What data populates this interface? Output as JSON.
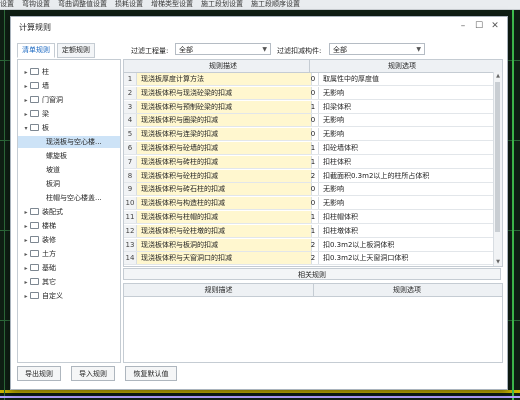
{
  "background": {
    "menu_items": [
      "设置",
      "弯钩设置",
      "弯曲调整值设置",
      "损耗设置",
      "增梯类型设置",
      "施工段划设置",
      "施工段顺序设置"
    ]
  },
  "dialog": {
    "title": "计算规则",
    "tabs": [
      "清单规则",
      "定额规则"
    ],
    "active_tab": 0,
    "filter_project_label": "过滤工程量:",
    "filter_project_value": "全部",
    "filter_deduct_label": "过滤扣减构件:",
    "filter_deduct_value": "全部"
  },
  "tree": [
    {
      "label": "柱",
      "type": "group",
      "expanded": false
    },
    {
      "label": "墙",
      "type": "group",
      "expanded": false
    },
    {
      "label": "门窗洞",
      "type": "group",
      "expanded": false
    },
    {
      "label": "梁",
      "type": "group",
      "expanded": false
    },
    {
      "label": "板",
      "type": "group",
      "expanded": true
    },
    {
      "label": "现浇板与空心楼...",
      "type": "leaf",
      "selected": true
    },
    {
      "label": "螺旋板",
      "type": "leaf"
    },
    {
      "label": "坡道",
      "type": "leaf"
    },
    {
      "label": "板洞",
      "type": "leaf"
    },
    {
      "label": "柱帽与空心楼盖...",
      "type": "leaf"
    },
    {
      "label": "装配式",
      "type": "group",
      "expanded": false
    },
    {
      "label": "楼梯",
      "type": "group",
      "expanded": false
    },
    {
      "label": "装修",
      "type": "group",
      "expanded": false
    },
    {
      "label": "土方",
      "type": "group",
      "expanded": false
    },
    {
      "label": "基础",
      "type": "group",
      "expanded": false
    },
    {
      "label": "其它",
      "type": "group",
      "expanded": false
    },
    {
      "label": "自定义",
      "type": "group",
      "expanded": false
    }
  ],
  "table": {
    "headers": [
      "规则描述",
      "规则选项"
    ],
    "rows": [
      {
        "idx": "1",
        "desc": "现浇板厚度计算方法",
        "val": "0",
        "opt": "取属性中的厚度值"
      },
      {
        "idx": "2",
        "desc": "现浇板体积与现浇砼梁的扣减",
        "val": "0",
        "opt": "无影响"
      },
      {
        "idx": "3",
        "desc": "现浇板体积与预制砼梁的扣减",
        "val": "1",
        "opt": "扣梁体积"
      },
      {
        "idx": "4",
        "desc": "现浇板体积与圈梁的扣减",
        "val": "0",
        "opt": "无影响"
      },
      {
        "idx": "5",
        "desc": "现浇板体积与连梁的扣减",
        "val": "0",
        "opt": "无影响"
      },
      {
        "idx": "6",
        "desc": "现浇板体积与砼墙的扣减",
        "val": "1",
        "opt": "扣砼墙体积"
      },
      {
        "idx": "7",
        "desc": "现浇板体积与砖柱的扣减",
        "val": "1",
        "opt": "扣柱体积"
      },
      {
        "idx": "8",
        "desc": "现浇板体积与砼柱的扣减",
        "val": "2",
        "opt": "扣截面积0.3m2以上的柱所占体积"
      },
      {
        "idx": "9",
        "desc": "现浇板体积与砖石柱的扣减",
        "val": "0",
        "opt": "无影响"
      },
      {
        "idx": "10",
        "desc": "现浇板体积与构造柱的扣减",
        "val": "0",
        "opt": "无影响"
      },
      {
        "idx": "11",
        "desc": "现浇板体积与柱帽的扣减",
        "val": "1",
        "opt": "扣柱帽体积"
      },
      {
        "idx": "12",
        "desc": "现浇板体积与砼柱墩的扣减",
        "val": "1",
        "opt": "扣柱墩体积"
      },
      {
        "idx": "13",
        "desc": "现浇板体积与板洞的扣减",
        "val": "2",
        "opt": "扣0.3m2以上板洞体积"
      },
      {
        "idx": "14",
        "desc": "现浇板体积与天窗洞口的扣减",
        "val": "2",
        "opt": "扣0.3m2以上天窗洞口体积"
      }
    ]
  },
  "related": {
    "title": "相关规则",
    "headers": [
      "规则描述",
      "规则选项"
    ]
  },
  "buttons": {
    "export": "导出规则",
    "import": "导入规则",
    "restore": "恢复默认值"
  },
  "colors": {
    "desc_cell_bg": "#fff7cf",
    "tree_selected_bg": "#cde3f7",
    "active_tab": "#1565c0"
  }
}
